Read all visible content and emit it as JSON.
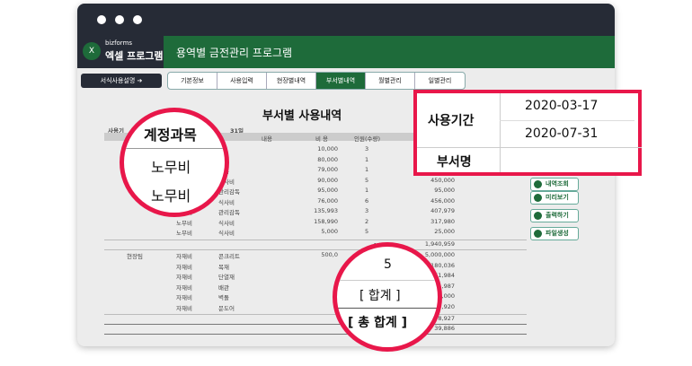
{
  "window": {
    "brand_small": "bizforms",
    "brand": "엑셀 프로그램",
    "app_title": "용역별 금전관리 프로그램"
  },
  "nav": {
    "guide": "서식사용설명 ➔",
    "tabs": [
      "기본정보",
      "사용입력",
      "현장별내역",
      "부서별내역",
      "월별관리",
      "일별관리"
    ],
    "active": 3
  },
  "report": {
    "title": "부서별 사용내역",
    "period_label": "사용기",
    "period_end": "31일",
    "headers": {
      "content": "내용",
      "cost": "비 용",
      "count": "인원(수량)"
    },
    "group1": {
      "rows": [
        {
          "acct": "",
          "content": "원",
          "cost": "10,000",
          "count": "3",
          "amount": ""
        },
        {
          "acct": "",
          "content": "독",
          "cost": "80,000",
          "count": "1",
          "amount": ""
        },
        {
          "acct": "",
          "content": "감독",
          "cost": "79,000",
          "count": "1",
          "amount": ""
        },
        {
          "acct": "",
          "content": "식사비",
          "cost": "90,000",
          "count": "5",
          "amount": "450,000"
        },
        {
          "acct": "",
          "content": "관리감독",
          "cost": "95,000",
          "count": "1",
          "amount": "95,000"
        },
        {
          "acct": "노무비",
          "content": "식사비",
          "cost": "76,000",
          "count": "6",
          "amount": "456,000"
        },
        {
          "acct": "노무비",
          "content": "관리감독",
          "cost": "135,993",
          "count": "3",
          "amount": "407,979"
        },
        {
          "acct": "노무비",
          "content": "식사비",
          "cost": "158,990",
          "count": "2",
          "amount": "317,980"
        },
        {
          "acct": "노무비",
          "content": "식사비",
          "cost": "5,000",
          "count": "5",
          "amount": "25,000"
        }
      ],
      "subtotal_label": "[ 합계 ]",
      "subtotal": "1,940,959"
    },
    "group2": {
      "dept": "현장팀",
      "rows": [
        {
          "acct": "자재비",
          "content": "콘크리트",
          "cost": "500,0",
          "amount": "5,000,000"
        },
        {
          "acct": "자재비",
          "content": "목재",
          "cost": "",
          "amount": "180,036"
        },
        {
          "acct": "자재비",
          "content": "단열재",
          "cost": "",
          "amount": "51,984"
        },
        {
          "acct": "자재비",
          "content": "배관",
          "cost": "",
          "amount": ",987"
        },
        {
          "acct": "자재비",
          "content": "벽돌",
          "cost": "",
          "amount": ",000"
        },
        {
          "acct": "자재비",
          "content": "문도어",
          "cost": "",
          "amount": ",920"
        }
      ],
      "subtotal": "8,927"
    },
    "grand_total": "39,886"
  },
  "buttons": [
    "내역조회",
    "미리보기",
    "출력하기",
    "파일생성"
  ],
  "callout_box": {
    "period_label": "사용기간",
    "start": "2020-03-17",
    "end": "2020-07-31",
    "dept_label": "부서명"
  },
  "callout1": {
    "header": "계정과목",
    "rows": [
      "노무비",
      "노무비"
    ]
  },
  "callout2": {
    "value": "5",
    "subtotal": "[ 합계 ]",
    "total": "[ 총 합계 ]"
  }
}
